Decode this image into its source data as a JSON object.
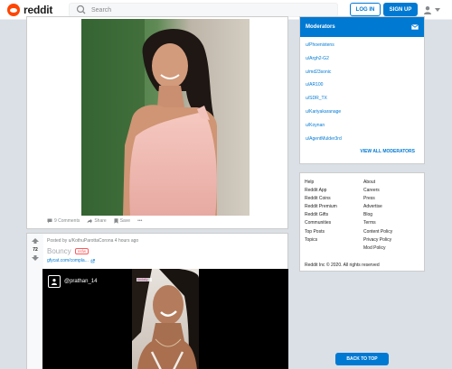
{
  "header": {
    "logo_text": "reddit",
    "search_placeholder": "Search",
    "login_label": "LOG IN",
    "signup_label": "SIGN UP"
  },
  "post1": {
    "comments": "9 Comments",
    "share": "Share",
    "save": "Save",
    "more": "•••"
  },
  "post2": {
    "score": "72",
    "posted_by": "Posted by u/KothuParottaCorona 4 hours ago",
    "title": "Bouncy",
    "tag": "nsfw",
    "link": "gfycat.com/compla...",
    "video_user": "@prathan_14",
    "watermark": "kimbelly"
  },
  "sidebar": {
    "moderators_title": "Moderators",
    "moderators": [
      "u/Phoenixtens",
      "u/Argh2-G2",
      "u/md23sonic",
      "u/AR100",
      "u/SDR_TX",
      "u/Kariyakaranage",
      "u/Koynan",
      "u/AgentMulder3rd"
    ],
    "view_all": "VIEW ALL MODERATORS"
  },
  "footer": {
    "col1": [
      "Help",
      "Reddit App",
      "Reddit Coins",
      "Reddit Premium",
      "Reddit Gifts",
      "Communities",
      "Top Posts",
      "Topics"
    ],
    "col2": [
      "About",
      "Careers",
      "Press",
      "Advertise",
      "Blog",
      "Terms",
      "Content Policy",
      "Privacy Policy",
      "Mod Policy"
    ],
    "copyright": "Reddit Inc © 2020. All rights reserved"
  },
  "back_to_top": "BACK TO TOP",
  "colors": {
    "brand": "#ff4500",
    "accent": "#0079d3",
    "background": "#dae0e6"
  }
}
